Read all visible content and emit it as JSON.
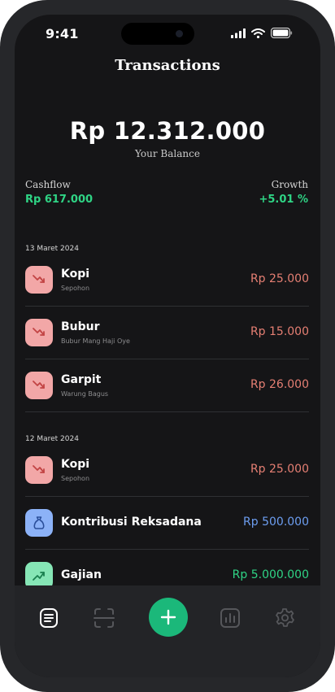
{
  "status_bar": {
    "time": "9:41"
  },
  "header": {
    "title": "Transactions"
  },
  "balance": {
    "amount": "Rp 12.312.000",
    "label": "Your Balance"
  },
  "stats": {
    "cashflow": {
      "label": "Cashflow",
      "value": "Rp 617.000"
    },
    "growth": {
      "label": "Growth",
      "value": "+5.01 %"
    }
  },
  "groups": [
    {
      "date": "13 Maret 2024",
      "items": [
        {
          "name": "Kopi",
          "subtitle": "Sepohon",
          "amount": "Rp 25.000",
          "type": "expense",
          "icon": "trend-down-icon"
        },
        {
          "name": "Bubur",
          "subtitle": "Bubur Mang Haji Oye",
          "amount": "Rp 15.000",
          "type": "expense",
          "icon": "trend-down-icon"
        },
        {
          "name": "Garpit",
          "subtitle": "Warung Bagus",
          "amount": "Rp 26.000",
          "type": "expense",
          "icon": "trend-down-icon"
        }
      ]
    },
    {
      "date": "12 Maret 2024",
      "items": [
        {
          "name": "Kopi",
          "subtitle": "Sepohon",
          "amount": "Rp 25.000",
          "type": "expense",
          "icon": "trend-down-icon"
        },
        {
          "name": "Kontribusi Reksadana",
          "subtitle": "",
          "amount": "Rp 500.000",
          "type": "investment",
          "icon": "money-bag-icon"
        },
        {
          "name": "Gajian",
          "subtitle": "",
          "amount": "Rp 5.000.000",
          "type": "income",
          "icon": "trend-up-icon"
        }
      ]
    }
  ],
  "tab_bar": {
    "tabs": [
      "transactions-icon",
      "scan-icon",
      "add-icon",
      "report-icon",
      "settings-icon"
    ],
    "active": "transactions-icon"
  },
  "colors": {
    "income": "#2fd485",
    "expense": "#e57f73",
    "investment": "#6d9ef1",
    "accent": "#1bb87a",
    "background": "#151517"
  }
}
